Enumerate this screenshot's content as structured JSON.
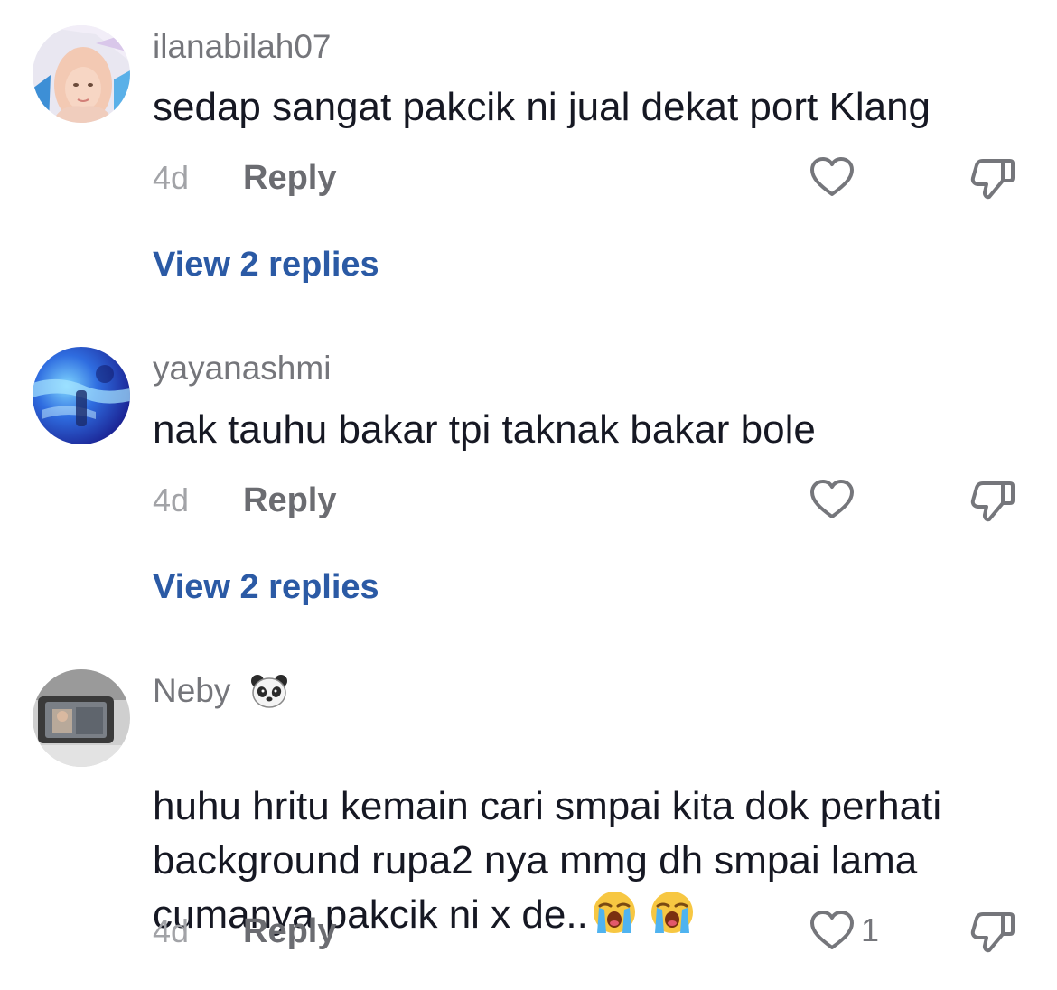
{
  "comments": [
    {
      "username": "ilanabilah07",
      "text": "sedap sangat pakcik ni jual dekat port Klang",
      "timestamp": "4d",
      "reply_label": "Reply",
      "like_count": "",
      "view_replies": "View 2 replies",
      "avatar_icon": "avatar-woman-hijab"
    },
    {
      "username": "yayanashmi",
      "text": "nak tauhu bakar tpi taknak bakar bole",
      "timestamp": "4d",
      "reply_label": "Reply",
      "like_count": "",
      "view_replies": "View 2 replies",
      "avatar_icon": "avatar-blue-photo"
    },
    {
      "username": "Neby",
      "username_badge_icon": "panda-icon",
      "text": "huhu hritu kemain cari smpai kita dok perhati\nbackground rupa2 nya mmg dh smpai lama\ncumanya pakcik ni x de..",
      "text_emojis": [
        "loudly-crying-face-icon",
        "loudly-crying-face-icon"
      ],
      "timestamp": "4d",
      "reply_label": "Reply",
      "like_count": "1",
      "avatar_icon": "avatar-car-mirror"
    }
  ],
  "colors": {
    "username": "#75767b",
    "text": "#161823",
    "timestamp": "#a2a3a7",
    "reply": "#6b6c71",
    "view_replies": "#2b5aa5",
    "icon_stroke": "#75767b"
  }
}
